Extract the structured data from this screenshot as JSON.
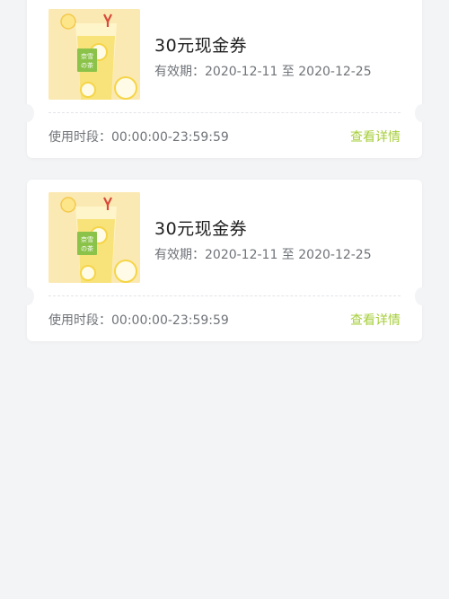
{
  "accent_color": "#a6ce39",
  "coupons": [
    {
      "title": "30元现金券",
      "validity": "有效期：2020-12-11 至 2020-12-25",
      "usage_hours": "使用时段：00:00:00-23:59:59",
      "details_label": "查看详情",
      "image_icon": "nayuki-lemon-tea-cup-image"
    },
    {
      "title": "30元现金券",
      "validity": "有效期：2020-12-11 至 2020-12-25",
      "usage_hours": "使用时段：00:00:00-23:59:59",
      "details_label": "查看详情",
      "image_icon": "nayuki-lemon-tea-cup-image"
    }
  ]
}
